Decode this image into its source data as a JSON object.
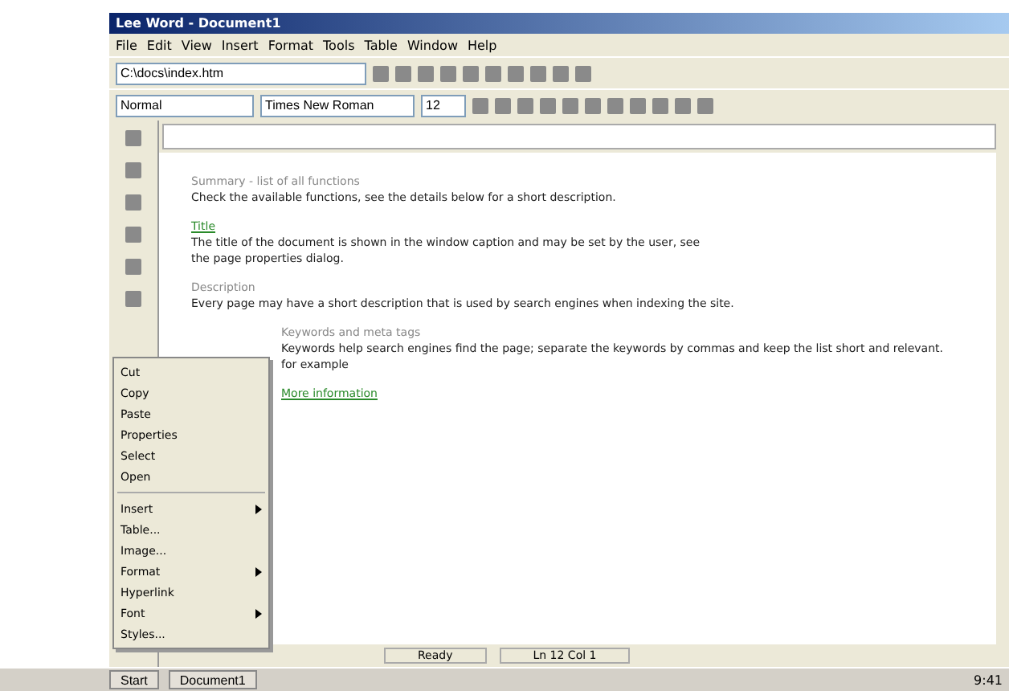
{
  "window": {
    "title": "Lee Word - Document1"
  },
  "menu": [
    "File",
    "Edit",
    "View",
    "Insert",
    "Format",
    "Tools",
    "Table",
    "Window",
    "Help"
  ],
  "address": {
    "value": "C:\\docs\\index.htm"
  },
  "font": {
    "style": "Normal",
    "family": "Times New Roman",
    "size": "12"
  },
  "document": [
    {
      "kind": "heading",
      "text": "Summary - list of all functions"
    },
    {
      "kind": "para",
      "text": "Check the available functions, see the details below for a short description."
    },
    {
      "kind": "link",
      "text": "Title"
    },
    {
      "kind": "para",
      "text": "The title of the document is shown in the window caption and may be set by the user, see"
    },
    {
      "kind": "para",
      "text": "the page properties dialog."
    },
    {
      "kind": "heading",
      "text": "Description"
    },
    {
      "kind": "para",
      "text": "Every page may have a short description that is used by search engines when indexing the site."
    },
    {
      "kind": "heading",
      "text": "Keywords and meta tags"
    },
    {
      "kind": "para",
      "text": "Keywords help search engines find the page; separate the keywords by commas and keep the list short and relevant."
    },
    {
      "kind": "para",
      "text": "for example"
    },
    {
      "kind": "link",
      "text": "More information"
    }
  ],
  "popup": [
    {
      "kind": "item",
      "label": "Cut",
      "submenu": false
    },
    {
      "kind": "item",
      "label": "Copy",
      "submenu": false
    },
    {
      "kind": "item",
      "label": "Paste",
      "submenu": false
    },
    {
      "kind": "item",
      "label": "Properties",
      "submenu": false
    },
    {
      "kind": "item",
      "label": "Select",
      "submenu": false
    },
    {
      "kind": "item",
      "label": "Open",
      "submenu": false
    },
    {
      "kind": "separator"
    },
    {
      "kind": "item",
      "label": "Insert",
      "submenu": true
    },
    {
      "kind": "item",
      "label": "Table...",
      "submenu": false
    },
    {
      "kind": "item",
      "label": "Image...",
      "submenu": false
    },
    {
      "kind": "item",
      "label": "Format",
      "submenu": true
    },
    {
      "kind": "item",
      "label": "Hyperlink",
      "submenu": false
    },
    {
      "kind": "item",
      "label": "Font",
      "submenu": true
    },
    {
      "kind": "item",
      "label": "Styles...",
      "submenu": false
    }
  ],
  "status": {
    "left": "Ready",
    "right": "Ln 12  Col 1"
  },
  "taskbar": {
    "start": "Start",
    "task": "Document1",
    "clock": "9:41"
  }
}
